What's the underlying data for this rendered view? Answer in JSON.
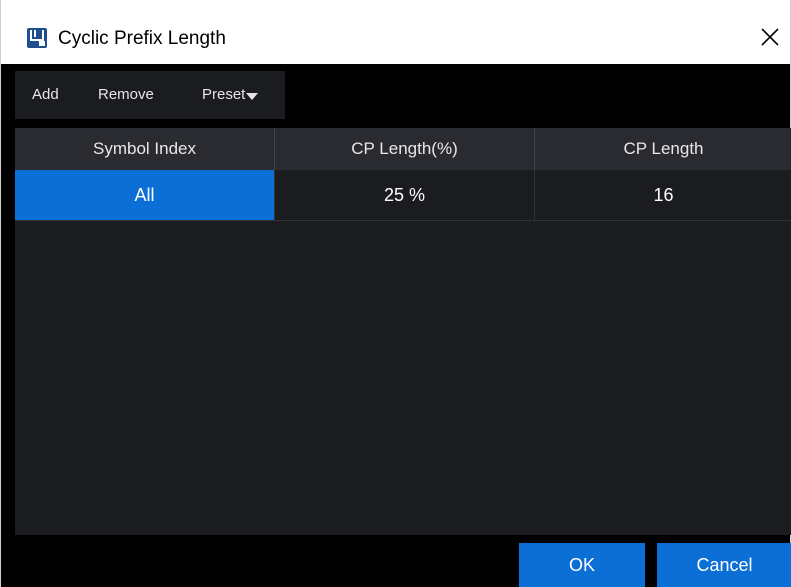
{
  "window": {
    "title": "Cyclic Prefix Length",
    "app_icon": "app-logo-icon",
    "close_icon": "close-icon"
  },
  "toolbar": {
    "add_label": "Add",
    "remove_label": "Remove",
    "preset_label": "Preset",
    "preset_icon": "caret-down-icon"
  },
  "table": {
    "columns": [
      "Symbol Index",
      "CP Length(%)",
      "CP Length"
    ],
    "rows": [
      {
        "symbol_index": "All",
        "cp_length_pct": "25 %",
        "cp_length": "16"
      }
    ]
  },
  "buttons": {
    "ok_label": "OK",
    "cancel_label": "Cancel"
  },
  "colors": {
    "accent": "#0c6fd6",
    "panel": "#1b1c20",
    "header": "#2a2b30",
    "background": "#000000"
  }
}
